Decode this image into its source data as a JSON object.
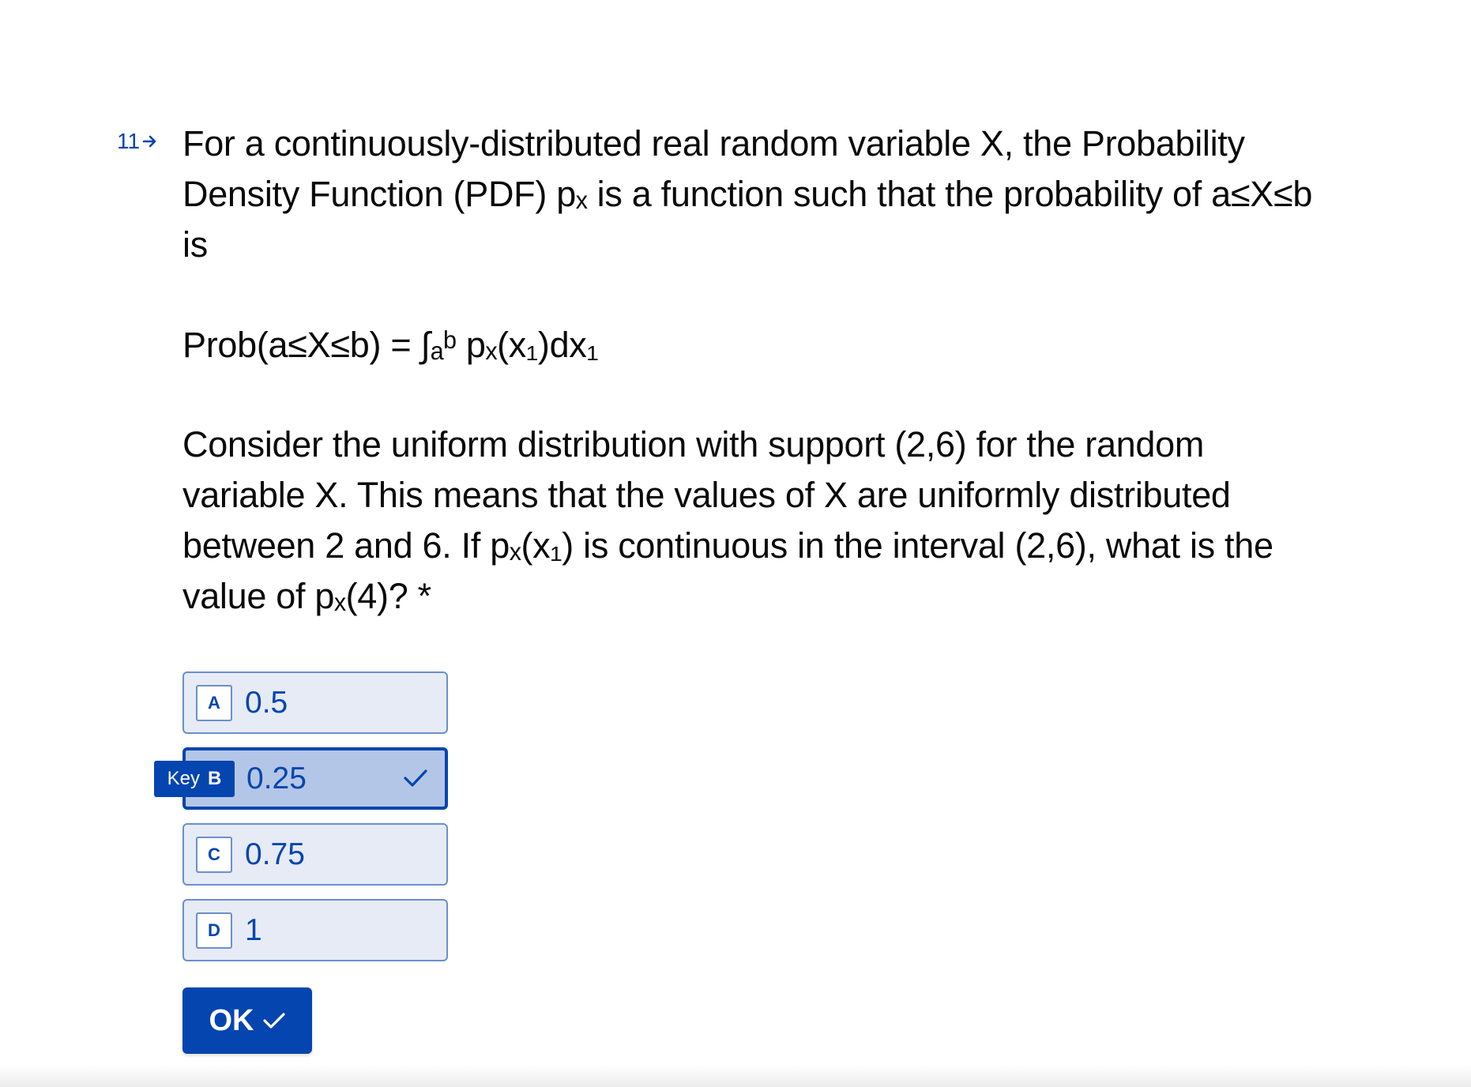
{
  "question": {
    "number": "11",
    "line1": "For a continuously-distributed real random variable X, the Probability Density Function (PDF) pₓ is a function such that the probability of a≤X≤b is",
    "formula": "Prob(a≤X≤b) = ∫ₐᵇ pₓ(x₁)dx₁",
    "line2": "Consider the uniform distribution with support (2,6) for the random variable X. This means that the values of X are uniformly distributed between 2 and 6. If pₓ(x₁) is continuous in the interval (2,6), what is the value of pₓ(4)? *"
  },
  "choices": [
    {
      "key": "A",
      "label": "0.5",
      "selected": false
    },
    {
      "key": "B",
      "label": "0.25",
      "selected": true
    },
    {
      "key": "C",
      "label": "0.75",
      "selected": false
    },
    {
      "key": "D",
      "label": "1",
      "selected": false
    }
  ],
  "keytag": {
    "prefix": "Key",
    "key": "B"
  },
  "ok_button": {
    "label": "OK"
  },
  "colors": {
    "accent": "#0445af",
    "choice_bg": "#e6ebf6",
    "choice_selected_bg": "#b4c6e7",
    "choice_border": "#6b8fcf"
  },
  "icons": {
    "question_arrow": "arrow-right-icon",
    "selected_check": "check-icon",
    "ok_check": "check-icon"
  }
}
